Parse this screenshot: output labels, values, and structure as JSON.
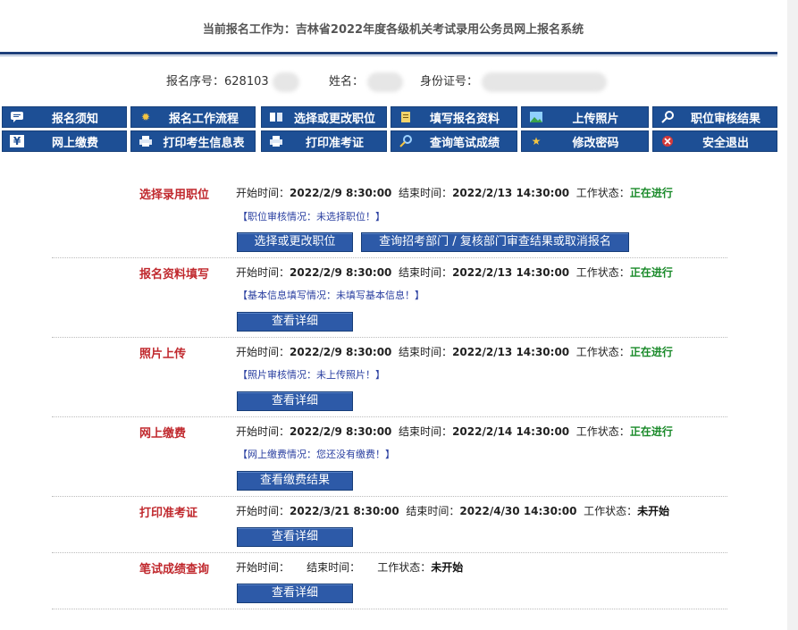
{
  "header": {
    "title": "当前报名工作为：吉林省2022年度各级机关考试录用公务员网上报名系统"
  },
  "info": {
    "reg_no_label": "报名序号：",
    "reg_no_value": "628103",
    "name_label": "姓名：",
    "id_label": "身份证号："
  },
  "nav": [
    {
      "label": "报名须知",
      "icon": "notice-icon"
    },
    {
      "label": "报名工作流程",
      "icon": "flow-icon"
    },
    {
      "label": "选择或更改职位",
      "icon": "position-icon"
    },
    {
      "label": "填写报名资料",
      "icon": "form-icon"
    },
    {
      "label": "上传照片",
      "icon": "photo-icon"
    },
    {
      "label": "职位审核结果",
      "icon": "review-icon"
    },
    {
      "label": "网上缴费",
      "icon": "payment-icon"
    },
    {
      "label": "打印考生信息表",
      "icon": "print-icon"
    },
    {
      "label": "打印准考证",
      "icon": "print-icon"
    },
    {
      "label": "查询笔试成绩",
      "icon": "search-icon"
    },
    {
      "label": "修改密码",
      "icon": "password-icon"
    },
    {
      "label": "安全退出",
      "icon": "logout-icon"
    }
  ],
  "labels": {
    "start": "开始时间：",
    "end": "结束时间：",
    "status": "工作状态："
  },
  "sections": [
    {
      "title": "选择录用职位",
      "start": "2022/2/9 8:30:00",
      "end": "2022/2/13 14:30:00",
      "status": "正在进行",
      "note": "【职位审核情况：未选择职位！】",
      "buttons": [
        "选择或更改职位",
        "查询招考部门 / 复核部门审查结果或取消报名"
      ]
    },
    {
      "title": "报名资料填写",
      "start": "2022/2/9 8:30:00",
      "end": "2022/2/13 14:30:00",
      "status": "正在进行",
      "note": "【基本信息填写情况：未填写基本信息！】",
      "buttons": [
        "查看详细"
      ]
    },
    {
      "title": "照片上传",
      "start": "2022/2/9 8:30:00",
      "end": "2022/2/13 14:30:00",
      "status": "正在进行",
      "note": "【照片审核情况：未上传照片！】",
      "buttons": [
        "查看详细"
      ]
    },
    {
      "title": "网上缴费",
      "start": "2022/2/9 8:30:00",
      "end": "2022/2/14 14:30:00",
      "status": "正在进行",
      "note": "【网上缴费情况：您还没有缴费！】",
      "buttons": [
        "查看缴费结果"
      ]
    },
    {
      "title": "打印准考证",
      "start": "2022/3/21 8:30:00",
      "end": "2022/4/30 14:30:00",
      "status": "未开始",
      "buttons": [
        "查看详细"
      ]
    },
    {
      "title": "笔试成绩查询",
      "start": "",
      "end": "",
      "status": "未开始",
      "buttons": [
        "查看详细"
      ]
    }
  ],
  "colors": {
    "nav_bg": "#1d4f95",
    "title_red": "#c0282d",
    "ongoing_green": "#1a8a2a",
    "note_blue": "#2a3fa0"
  }
}
